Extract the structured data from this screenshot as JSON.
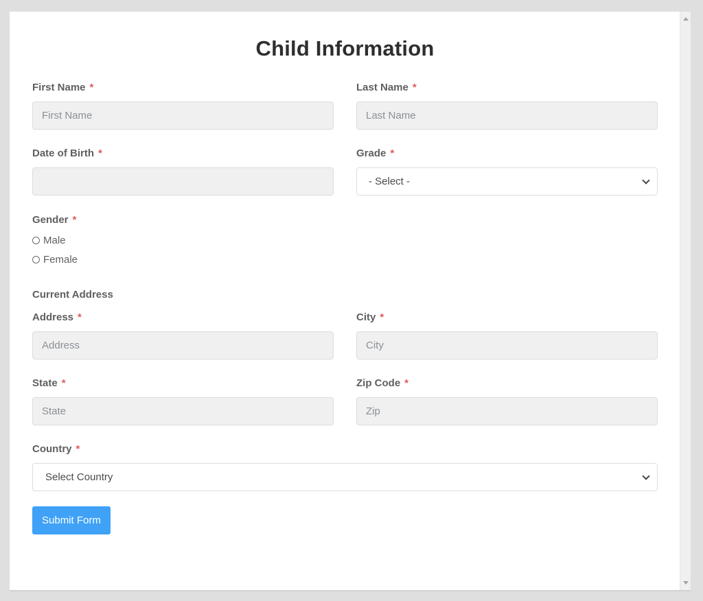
{
  "form": {
    "title": "Child Information",
    "required_marker": "*",
    "fields": {
      "first_name": {
        "label": "First Name",
        "placeholder": "First Name",
        "value": ""
      },
      "last_name": {
        "label": "Last Name",
        "placeholder": "Last Name",
        "value": ""
      },
      "dob": {
        "label": "Date of Birth",
        "placeholder": "",
        "value": ""
      },
      "grade": {
        "label": "Grade",
        "selected": "- Select -"
      },
      "gender": {
        "label": "Gender",
        "options": [
          "Male",
          "Female"
        ],
        "selected": null
      },
      "address": {
        "label": "Address",
        "placeholder": "Address",
        "value": ""
      },
      "city": {
        "label": "City",
        "placeholder": "City",
        "value": ""
      },
      "state": {
        "label": "State",
        "placeholder": "State",
        "value": ""
      },
      "zip": {
        "label": "Zip Code",
        "placeholder": "Zip",
        "value": ""
      },
      "country": {
        "label": "Country",
        "selected": "Select Country"
      }
    },
    "section_current_address": "Current Address",
    "submit_label": "Submit Form"
  },
  "colors": {
    "accent": "#3fa2f7",
    "required": "#e05a5a",
    "input_bg": "#f0f0f0",
    "page_bg": "#dfdfdf"
  }
}
